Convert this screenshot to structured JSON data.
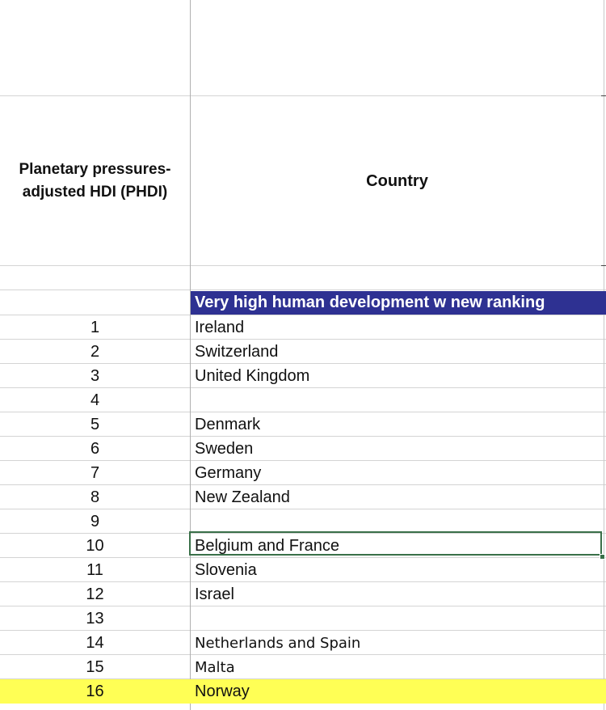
{
  "header": {
    "phdi_label": "Planetary pressures-adjusted HDI (PHDI)",
    "phdi_line1": "Planetary pressures-",
    "phdi_line2": "adjusted HDI (PHDI)",
    "country_label": "Country"
  },
  "section": {
    "title": "Very high human development w new ranking",
    "color": "#2e3192"
  },
  "rows": [
    {
      "rank": "1",
      "country": "Ireland"
    },
    {
      "rank": "2",
      "country": "Switzerland"
    },
    {
      "rank": "3",
      "country": "United Kingdom"
    },
    {
      "rank": "4",
      "country": ""
    },
    {
      "rank": "5",
      "country": "Denmark"
    },
    {
      "rank": "6",
      "country": "Sweden"
    },
    {
      "rank": "7",
      "country": "Germany"
    },
    {
      "rank": "8",
      "country": "New Zealand"
    },
    {
      "rank": "9",
      "country": ""
    },
    {
      "rank": "10",
      "country": "Belgium and France"
    },
    {
      "rank": "11",
      "country": "Slovenia"
    },
    {
      "rank": "12",
      "country": "Israel"
    },
    {
      "rank": "13",
      "country": ""
    },
    {
      "rank": "14",
      "country": "Netherlands and Spain"
    },
    {
      "rank": "15",
      "country": "Malta"
    },
    {
      "rank": "16",
      "country": "Norway"
    }
  ],
  "highlight_color": "#ffff55",
  "selection_color": "#3a7049"
}
